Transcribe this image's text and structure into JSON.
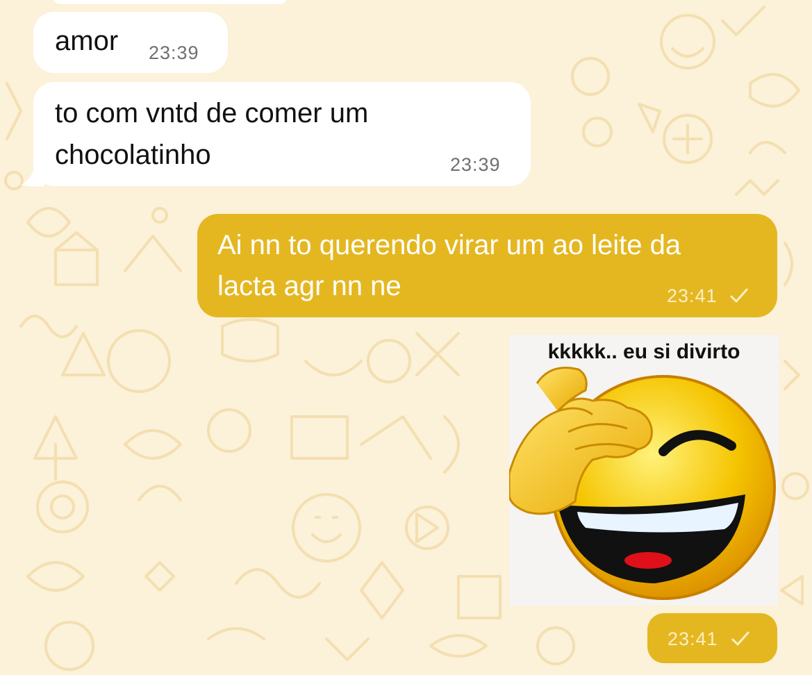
{
  "chat": {
    "wallpaper": {
      "base_color": "#fcf1d9",
      "doodle_color": "#f3dfb0"
    },
    "colors": {
      "incoming_bubble": "#ffffff",
      "outgoing_bubble": "#e4b721"
    },
    "messages": [
      {
        "direction": "incoming",
        "text": "amor",
        "time": "23:39"
      },
      {
        "direction": "incoming",
        "text_lines": [
          "to com vntd de comer um",
          "chocolatinho"
        ],
        "time": "23:39"
      },
      {
        "direction": "outgoing",
        "text_lines": [
          "Ai nn to querendo virar um ao leite da",
          "lacta agr nn ne"
        ],
        "time": "23:41",
        "status_icon": "single-check-icon"
      },
      {
        "direction": "outgoing",
        "type": "sticker",
        "sticker_caption": "kkkkk.. eu si divirto",
        "sticker_icon": "facepalm-laughing-emoji",
        "time": "23:41",
        "status_icon": "single-check-icon"
      }
    ]
  }
}
